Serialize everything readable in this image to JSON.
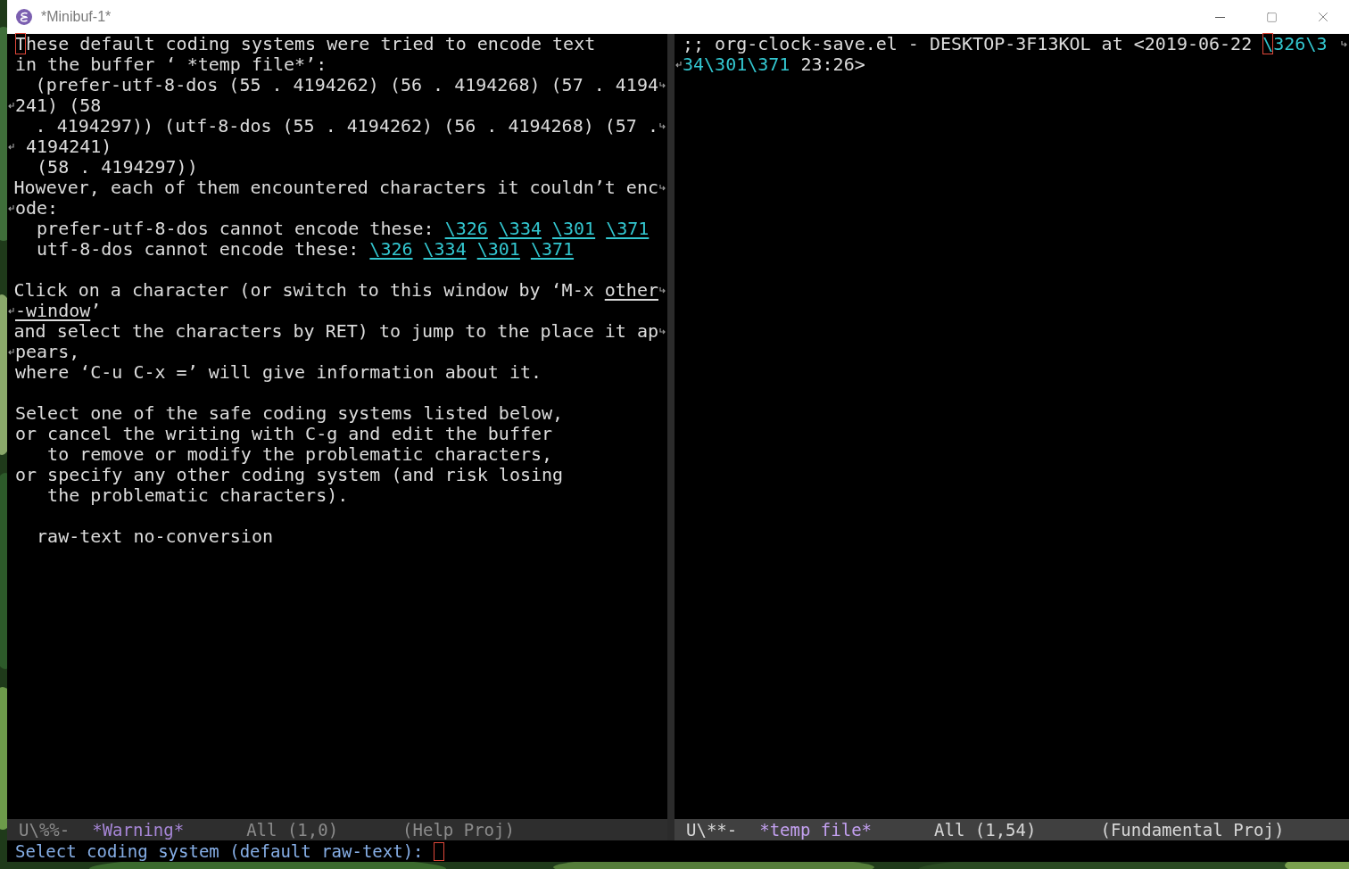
{
  "window": {
    "title": "*Minibuf-1*"
  },
  "left_window": {
    "lines": [
      {
        "kind": "text",
        "segments": [
          {
            "text": "T",
            "kind": "cursor"
          },
          {
            "text": "hese default coding systems were tried to encode text",
            "kind": "plain"
          }
        ]
      },
      {
        "kind": "text",
        "segments": [
          {
            "text": "in the buffer ‘ *temp file*’:",
            "kind": "plain"
          }
        ]
      },
      {
        "kind": "text",
        "wrapped": true,
        "segments": [
          {
            "text": "  (prefer-utf-8-dos (55 . 4194262) (56 . 4194268) (57 . 4194",
            "kind": "plain"
          }
        ]
      },
      {
        "kind": "text",
        "continued": true,
        "segments": [
          {
            "text": "241) (58",
            "kind": "plain"
          }
        ]
      },
      {
        "kind": "text",
        "wrapped": true,
        "segments": [
          {
            "text": "  . 4194297)) (utf-8-dos (55 . 4194262) (56 . 4194268) (57 .",
            "kind": "plain"
          }
        ]
      },
      {
        "kind": "text",
        "continued": true,
        "segments": [
          {
            "text": " 4194241)",
            "kind": "plain"
          }
        ]
      },
      {
        "kind": "text",
        "segments": [
          {
            "text": "  (58 . 4194297))",
            "kind": "plain"
          }
        ]
      },
      {
        "kind": "text",
        "wrapped": true,
        "segments": [
          {
            "text": "However, each of them encountered characters it couldn’t enc",
            "kind": "plain"
          }
        ]
      },
      {
        "kind": "text",
        "continued": true,
        "segments": [
          {
            "text": "ode:",
            "kind": "plain"
          }
        ]
      },
      {
        "kind": "text",
        "segments": [
          {
            "text": "  prefer-utf-8-dos cannot encode these: ",
            "kind": "plain"
          },
          {
            "text": "\\326",
            "kind": "link"
          },
          {
            "text": "\\334",
            "kind": "link"
          },
          {
            "text": "\\301",
            "kind": "link"
          },
          {
            "text": "\\371",
            "kind": "link"
          }
        ]
      },
      {
        "kind": "text",
        "segments": [
          {
            "text": "  utf-8-dos cannot encode these: ",
            "kind": "plain"
          },
          {
            "text": "\\326",
            "kind": "link"
          },
          {
            "text": "\\334",
            "kind": "link"
          },
          {
            "text": "\\301",
            "kind": "link"
          },
          {
            "text": "\\371",
            "kind": "link"
          }
        ]
      },
      {
        "kind": "blank"
      },
      {
        "kind": "text",
        "wrapped": true,
        "segments": [
          {
            "text": "Click on a character (or switch to this window by ‘M-x ",
            "kind": "plain"
          },
          {
            "text": "other",
            "kind": "button"
          }
        ]
      },
      {
        "kind": "text",
        "continued": true,
        "segments": [
          {
            "text": "-window",
            "kind": "button"
          },
          {
            "text": "’",
            "kind": "plain"
          }
        ]
      },
      {
        "kind": "text",
        "wrapped": true,
        "segments": [
          {
            "text": "and select the characters by RET) to jump to the place it ap",
            "kind": "plain"
          }
        ]
      },
      {
        "kind": "text",
        "continued": true,
        "segments": [
          {
            "text": "pears,",
            "kind": "plain"
          }
        ]
      },
      {
        "kind": "text",
        "segments": [
          {
            "text": "where ‘C-u C-x =’ will give information about it.",
            "kind": "plain"
          }
        ]
      },
      {
        "kind": "blank"
      },
      {
        "kind": "text",
        "segments": [
          {
            "text": "Select one of the safe coding systems listed below,",
            "kind": "plain"
          }
        ]
      },
      {
        "kind": "text",
        "segments": [
          {
            "text": "or cancel the writing with C-g and edit the buffer",
            "kind": "plain"
          }
        ]
      },
      {
        "kind": "text",
        "segments": [
          {
            "text": "   to remove or modify the problematic characters,",
            "kind": "plain"
          }
        ]
      },
      {
        "kind": "text",
        "segments": [
          {
            "text": "or specify any other coding system (and risk losing",
            "kind": "plain"
          }
        ]
      },
      {
        "kind": "text",
        "segments": [
          {
            "text": "   the problematic characters).",
            "kind": "plain"
          }
        ]
      },
      {
        "kind": "blank"
      },
      {
        "kind": "text",
        "segments": [
          {
            "text": "  raw-text no-conversion",
            "kind": "plain"
          }
        ]
      }
    ],
    "mode_line": {
      "active": false,
      "status": "U\\%%-",
      "buffer": "*Warning*",
      "position": "All (1,0)",
      "modes": "(Help Proj)"
    }
  },
  "right_window": {
    "lines": [
      {
        "kind": "text",
        "wrapped": true,
        "segments": [
          {
            "text": ";; org-clock-save.el - DESKTOP-3F13KOL at <2019-06-22 ",
            "kind": "plain"
          },
          {
            "text": "\\",
            "kind": "cursor_escape"
          },
          {
            "text": "326\\3",
            "kind": "escape"
          }
        ]
      },
      {
        "kind": "text",
        "continued": true,
        "segments": [
          {
            "text": "34\\301\\371",
            "kind": "escape"
          },
          {
            "text": " 23:26>",
            "kind": "plain"
          }
        ]
      }
    ],
    "mode_line": {
      "active": true,
      "status": "U\\**-",
      "buffer": "*temp file*",
      "position": "All (1,54)",
      "modes": "(Fundamental Proj)"
    }
  },
  "minibuffer": {
    "prompt": "Select coding system (default raw-text): "
  }
}
